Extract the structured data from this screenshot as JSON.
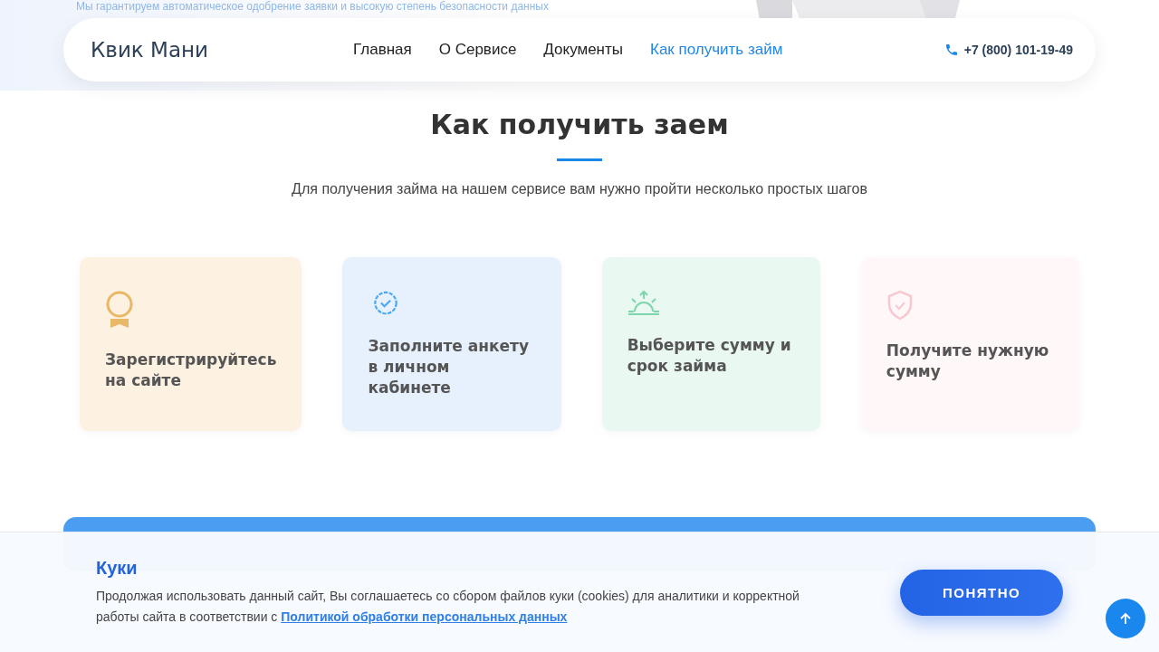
{
  "tagline": "Мы гарантируем автоматическое одобрение заявки и высокую степень безопасности данных",
  "header": {
    "logo": "Квик Мани",
    "nav": [
      {
        "label": "Главная",
        "selected": false
      },
      {
        "label": "О Сервисе",
        "selected": false
      },
      {
        "label": "Документы",
        "selected": false
      },
      {
        "label": "Как получить займ",
        "selected": true
      }
    ],
    "phone": "+7 (800) 101-19-49"
  },
  "section": {
    "title": "Как получить заем",
    "subtitle": "Для получения займа на нашем сервисе вам нужно пройти несколько простых шагов",
    "steps": [
      {
        "kind": "award",
        "color": "#fdf1e2",
        "text": "Зарегистрируйтесь на сайте"
      },
      {
        "kind": "badge",
        "color": "#e6f1fd",
        "text": "Заполните анкету в личном кабинете"
      },
      {
        "kind": "sunrise",
        "color": "#e9f8f0",
        "text": "Выберите сумму и срок займа"
      },
      {
        "kind": "shield",
        "color": "#fff7f8",
        "text": "Получите нужную сумму"
      }
    ]
  },
  "cookie": {
    "title": "Куки",
    "text": "Продолжая использовать данный сайт, Вы соглашаетесь со сбором файлов куки (cookies) для аналитики и корректной работы сайта в соответствии с ",
    "link": "Политикой обработки персональных данных",
    "button": "ПОНЯТНО"
  }
}
